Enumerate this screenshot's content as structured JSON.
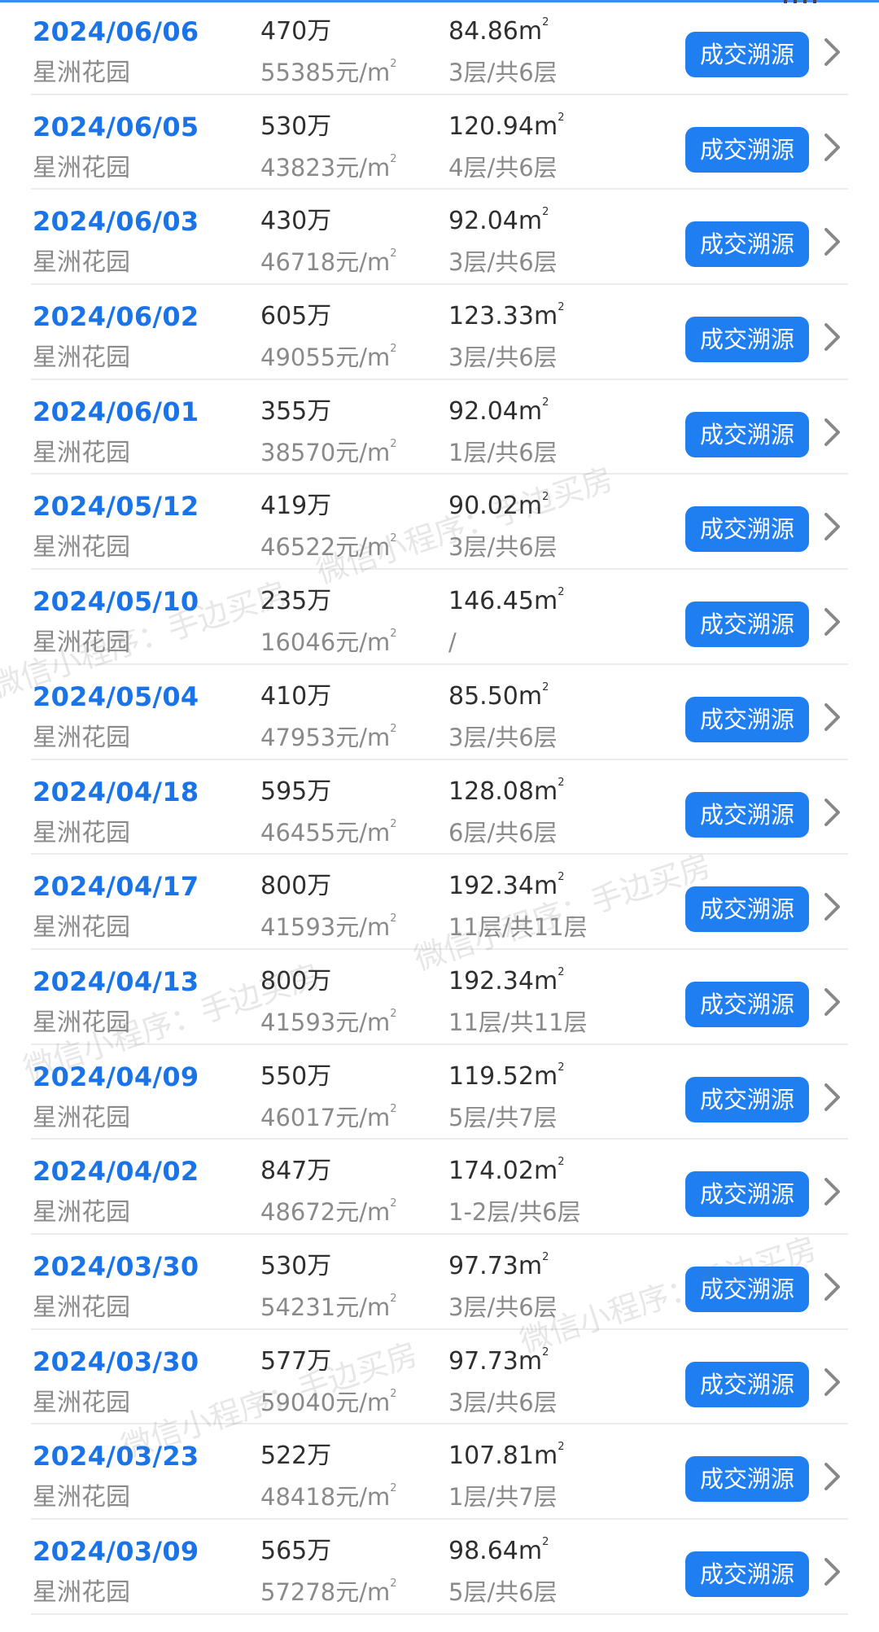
{
  "action_label": "成交溯源",
  "watermark_text": "微信小程序：手边买房",
  "colors": {
    "accent": "#1f7ef0",
    "date": "#1a74e8",
    "muted": "#8a8a8a"
  },
  "rows": [
    {
      "date": "2024/06/06",
      "name": "星洲花园",
      "price": "470万",
      "unit_price": "55385元/m",
      "area": "84.86m",
      "floor": "3层/共6层"
    },
    {
      "date": "2024/06/05",
      "name": "星洲花园",
      "price": "530万",
      "unit_price": "43823元/m",
      "area": "120.94m",
      "floor": "4层/共6层"
    },
    {
      "date": "2024/06/03",
      "name": "星洲花园",
      "price": "430万",
      "unit_price": "46718元/m",
      "area": "92.04m",
      "floor": "3层/共6层"
    },
    {
      "date": "2024/06/02",
      "name": "星洲花园",
      "price": "605万",
      "unit_price": "49055元/m",
      "area": "123.33m",
      "floor": "3层/共6层"
    },
    {
      "date": "2024/06/01",
      "name": "星洲花园",
      "price": "355万",
      "unit_price": "38570元/m",
      "area": "92.04m",
      "floor": "1层/共6层"
    },
    {
      "date": "2024/05/12",
      "name": "星洲花园",
      "price": "419万",
      "unit_price": "46522元/m",
      "area": "90.02m",
      "floor": "3层/共6层"
    },
    {
      "date": "2024/05/10",
      "name": "星洲花园",
      "price": "235万",
      "unit_price": "16046元/m",
      "area": "146.45m",
      "floor": "/"
    },
    {
      "date": "2024/05/04",
      "name": "星洲花园",
      "price": "410万",
      "unit_price": "47953元/m",
      "area": "85.50m",
      "floor": "3层/共6层"
    },
    {
      "date": "2024/04/18",
      "name": "星洲花园",
      "price": "595万",
      "unit_price": "46455元/m",
      "area": "128.08m",
      "floor": "6层/共6层"
    },
    {
      "date": "2024/04/17",
      "name": "星洲花园",
      "price": "800万",
      "unit_price": "41593元/m",
      "area": "192.34m",
      "floor": "11层/共11层"
    },
    {
      "date": "2024/04/13",
      "name": "星洲花园",
      "price": "800万",
      "unit_price": "41593元/m",
      "area": "192.34m",
      "floor": "11层/共11层"
    },
    {
      "date": "2024/04/09",
      "name": "星洲花园",
      "price": "550万",
      "unit_price": "46017元/m",
      "area": "119.52m",
      "floor": "5层/共7层"
    },
    {
      "date": "2024/04/02",
      "name": "星洲花园",
      "price": "847万",
      "unit_price": "48672元/m",
      "area": "174.02m",
      "floor": "1-2层/共6层"
    },
    {
      "date": "2024/03/30",
      "name": "星洲花园",
      "price": "530万",
      "unit_price": "54231元/m",
      "area": "97.73m",
      "floor": "3层/共6层"
    },
    {
      "date": "2024/03/30",
      "name": "星洲花园",
      "price": "577万",
      "unit_price": "59040元/m",
      "area": "97.73m",
      "floor": "3层/共6层"
    },
    {
      "date": "2024/03/23",
      "name": "星洲花园",
      "price": "522万",
      "unit_price": "48418元/m",
      "area": "107.81m",
      "floor": "1层/共7层"
    },
    {
      "date": "2024/03/09",
      "name": "星洲花园",
      "price": "565万",
      "unit_price": "57278元/m",
      "area": "98.64m",
      "floor": "5层/共6层"
    }
  ]
}
